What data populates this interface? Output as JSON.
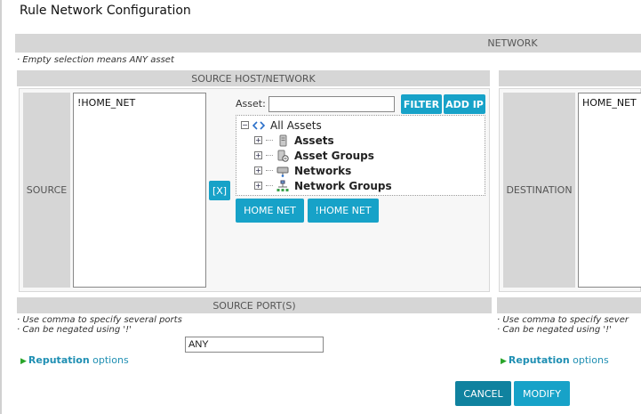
{
  "dialog": {
    "title": "Rule Network Configuration"
  },
  "network": {
    "header": "NETWORK",
    "note": "· Empty selection means ANY asset"
  },
  "source": {
    "header": "SOURCE HOST/NETWORK",
    "label": "SOURCE",
    "selected": [
      "!HOME_NET"
    ],
    "remove_button": "[X]",
    "asset_label": "Asset:",
    "asset_value": "",
    "filter_button": "FILTER",
    "add_ip_button": "ADD IP",
    "tree": {
      "root": "All Assets",
      "items": [
        "Assets",
        "Asset Groups",
        "Networks",
        "Network Groups"
      ]
    },
    "home_net_button": "HOME NET",
    "not_home_net_button": "!HOME NET"
  },
  "destination": {
    "label": "DESTINATION",
    "selected": [
      "HOME_NET"
    ]
  },
  "source_ports": {
    "header": "SOURCE PORT(S)",
    "note1": "· Use comma to specify several ports",
    "note2": "· Can be negated using '!'",
    "value": "ANY"
  },
  "destination_ports": {
    "note1": "· Use comma to specify sever",
    "note2": "· Can be negated using '!'"
  },
  "reputation": {
    "bold": "Reputation",
    "rest": "options"
  },
  "footer": {
    "cancel": "CANCEL",
    "modify": "MODIFY"
  },
  "colors": {
    "accent": "#17a2c8",
    "accent_dark": "#10829f",
    "header_gray": "#d6d6d6"
  }
}
